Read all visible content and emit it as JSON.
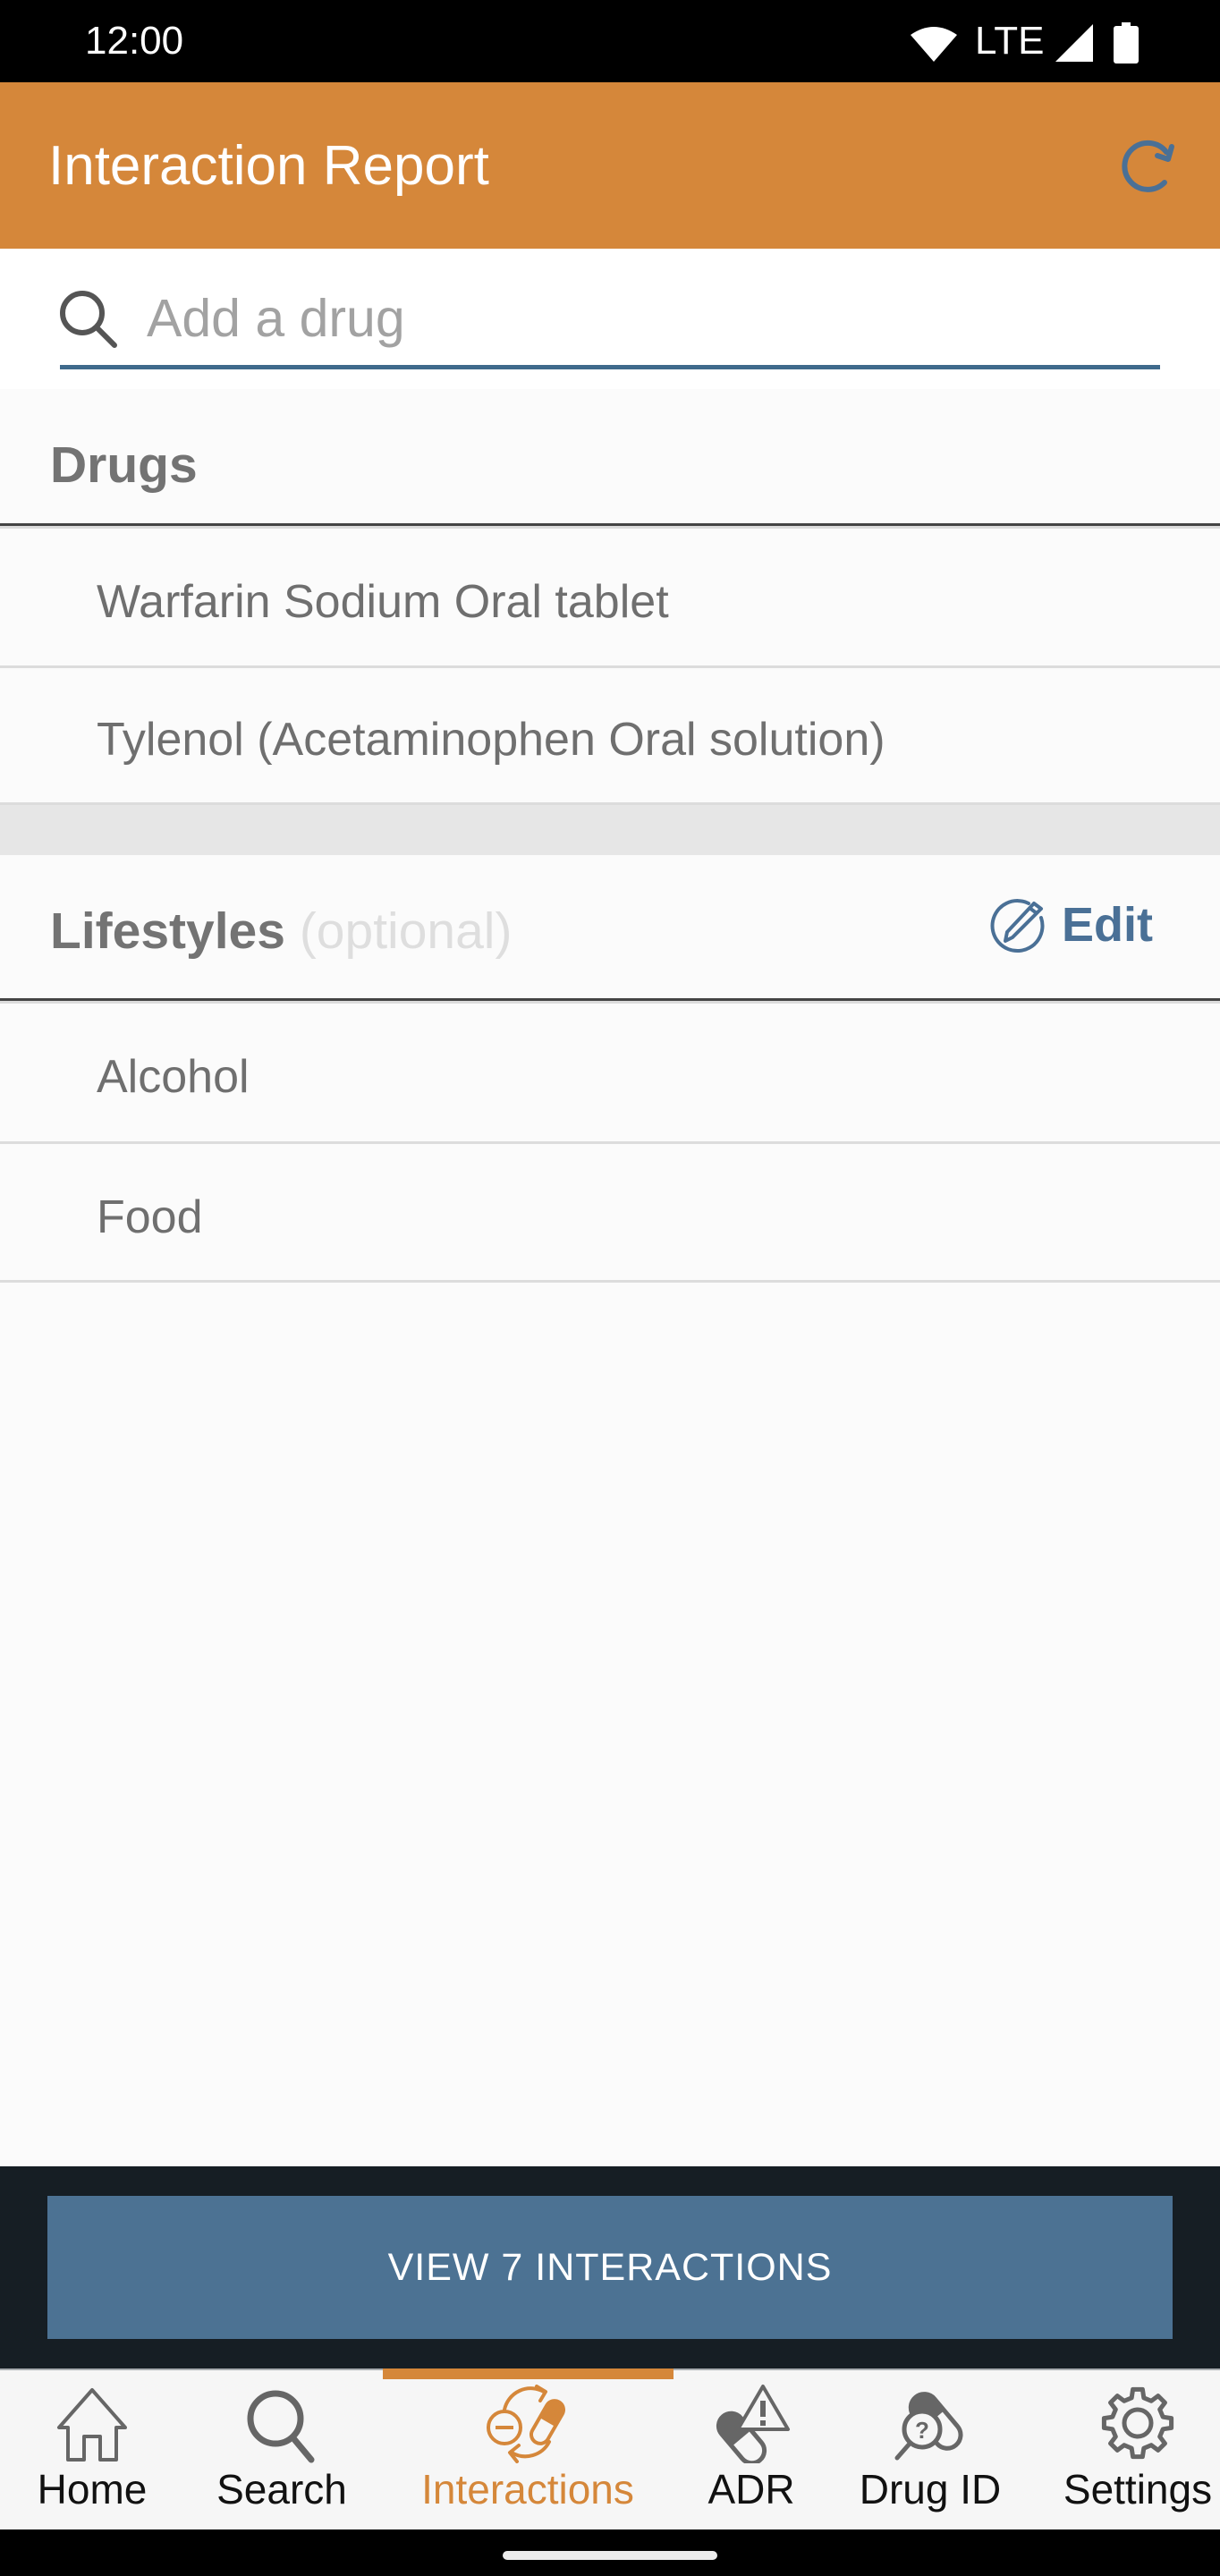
{
  "status_bar": {
    "time": "12:00",
    "network": "LTE",
    "icons": [
      "wifi-icon",
      "lte-signal-icon",
      "battery-icon"
    ]
  },
  "app_bar": {
    "title": "Interaction Report",
    "refresh_icon": "refresh-icon"
  },
  "search": {
    "placeholder": "Add a drug",
    "value": ""
  },
  "drugs": {
    "title": "Drugs",
    "items": [
      {
        "label": "Warfarin Sodium Oral tablet"
      },
      {
        "label": "Tylenol (Acetaminophen Oral solution)"
      }
    ]
  },
  "lifestyles": {
    "title": "Lifestyles",
    "optional_label": "(optional)",
    "edit_label": "Edit",
    "items": [
      {
        "label": "Alcohol"
      },
      {
        "label": "Food"
      }
    ]
  },
  "action": {
    "view_button_label": "VIEW 7 INTERACTIONS",
    "interaction_count": 7
  },
  "bottom_nav": {
    "active": "Interactions",
    "items": [
      {
        "label": "Home",
        "icon": "home-icon"
      },
      {
        "label": "Search",
        "icon": "search-icon"
      },
      {
        "label": "Interactions",
        "icon": "interactions-icon"
      },
      {
        "label": "ADR",
        "icon": "adr-icon"
      },
      {
        "label": "Drug ID",
        "icon": "drug-id-icon"
      },
      {
        "label": "Settings",
        "icon": "gear-icon"
      }
    ]
  },
  "colors": {
    "accent": "#d5873a",
    "primary_blue": "#4c7293",
    "action_panel": "#161e24",
    "text_gray": "#6f6f6f"
  }
}
